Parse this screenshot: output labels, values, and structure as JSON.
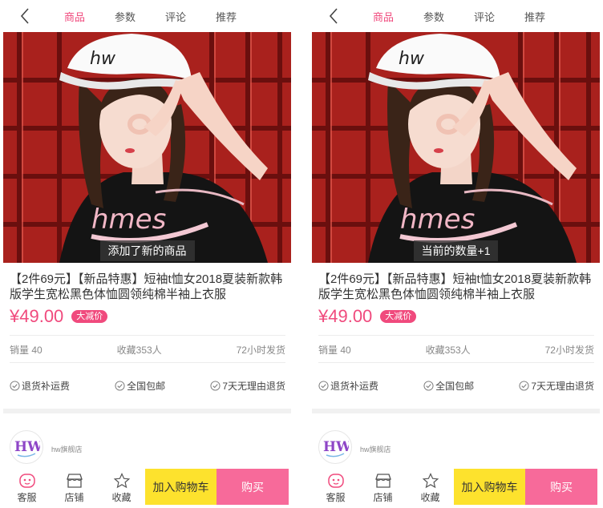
{
  "tabs": [
    "商品",
    "参数",
    "评论",
    "推荐"
  ],
  "product": {
    "title": "【2件69元】【新品特惠】短袖t恤女2018夏装新款韩版学生宽松黑色体恤圆领纯棉半袖上衣服",
    "price": "¥49.00",
    "badge": "大减价",
    "sales": "销量 40",
    "favorites": "收藏353人",
    "shipping": "72小时发货",
    "guarantees": [
      "退货补运费",
      "全国包邮",
      "7天无理由退货"
    ]
  },
  "shirt_print": "hmes",
  "store": {
    "name": "hw旗舰店",
    "logo_text": "HW"
  },
  "bottom": {
    "service": "客服",
    "shop": "店铺",
    "favorite": "收藏",
    "add_to_cart": "加入购物车",
    "buy": "购买"
  },
  "panels": [
    {
      "toast": "添加了新的商品"
    },
    {
      "toast": "当前的数量+1"
    }
  ],
  "colors": {
    "accent": "#f04a7d",
    "cart_button": "#fde22d",
    "buy_button": "#f76a9a",
    "photo_background": "#8b1a1a"
  },
  "icons": [
    "back-arrow-icon",
    "check-circle-icon",
    "service-icon",
    "store-icon",
    "star-icon"
  ]
}
